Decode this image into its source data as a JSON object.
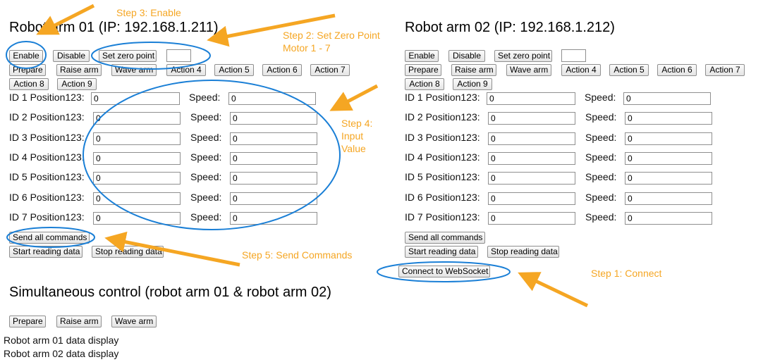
{
  "arm1": {
    "title": "Robot arm 01 (IP: 192.168.1.211)",
    "buttons_row1": [
      "Enable",
      "Disable",
      "Set zero point"
    ],
    "zero_value": "",
    "buttons_row2": [
      "Prepare",
      "Raise arm",
      "Wave arm",
      "Action 4",
      "Action 5",
      "Action 6",
      "Action 7"
    ],
    "buttons_row3": [
      "Action 8",
      "Action 9"
    ],
    "rows": [
      {
        "label": "ID 1 Position123:",
        "position": "0",
        "speed_label": "Speed:",
        "speed": "0"
      },
      {
        "label": "ID 2 Position123:",
        "position": "0",
        "speed_label": "Speed:",
        "speed": "0"
      },
      {
        "label": "ID 3 Position123:",
        "position": "0",
        "speed_label": "Speed:",
        "speed": "0"
      },
      {
        "label": "ID 4 Position123:",
        "position": "0",
        "speed_label": "Speed:",
        "speed": "0"
      },
      {
        "label": "ID 5 Position123:",
        "position": "0",
        "speed_label": "Speed:",
        "speed": "0"
      },
      {
        "label": "ID 6 Position123:",
        "position": "0",
        "speed_label": "Speed:",
        "speed": "0"
      },
      {
        "label": "ID 7 Position123:",
        "position": "0",
        "speed_label": "Speed:",
        "speed": "0"
      }
    ],
    "send_all": "Send all commands",
    "start_reading": "Start reading data",
    "stop_reading": "Stop reading data"
  },
  "arm2": {
    "title": "Robot arm 02 (IP: 192.168.1.212)",
    "buttons_row1": [
      "Enable",
      "Disable",
      "Set zero point"
    ],
    "zero_value": "",
    "buttons_row2": [
      "Prepare",
      "Raise arm",
      "Wave arm",
      "Action 4",
      "Action 5",
      "Action 6",
      "Action 7"
    ],
    "buttons_row3": [
      "Action 8",
      "Action 9"
    ],
    "rows": [
      {
        "label": "ID 1 Position123:",
        "position": "0",
        "speed_label": "Speed:",
        "speed": "0"
      },
      {
        "label": "ID 2 Position123:",
        "position": "0",
        "speed_label": "Speed:",
        "speed": "0"
      },
      {
        "label": "ID 3 Position123:",
        "position": "0",
        "speed_label": "Speed:",
        "speed": "0"
      },
      {
        "label": "ID 4 Position123:",
        "position": "0",
        "speed_label": "Speed:",
        "speed": "0"
      },
      {
        "label": "ID 5 Position123:",
        "position": "0",
        "speed_label": "Speed:",
        "speed": "0"
      },
      {
        "label": "ID 6 Position123:",
        "position": "0",
        "speed_label": "Speed:",
        "speed": "0"
      },
      {
        "label": "ID 7 Position123:",
        "position": "0",
        "speed_label": "Speed:",
        "speed": "0"
      }
    ],
    "send_all": "Send all commands",
    "start_reading": "Start reading data",
    "stop_reading": "Stop reading data",
    "connect": "Connect to WebSocket"
  },
  "simul": {
    "title": "Simultaneous control (robot arm 01 & robot arm 02)",
    "buttons": [
      "Prepare",
      "Raise arm",
      "Wave arm"
    ]
  },
  "display": {
    "arm1": "Robot arm 01 data display",
    "arm2": "Robot arm 02 data display"
  },
  "annotations": {
    "step1": "Step 1: Connect",
    "step2_line1": "Step 2: Set Zero Point",
    "step2_line2": "Motor 1 - 7",
    "step3": "Step 3: Enable",
    "step4_line1": "Step 4:",
    "step4_line2": "Input",
    "step4_line3": "Value",
    "step5": "Step 5: Send Commands"
  },
  "colors": {
    "annotation": "#f5a623",
    "highlight_ring": "#1a7fd6"
  }
}
